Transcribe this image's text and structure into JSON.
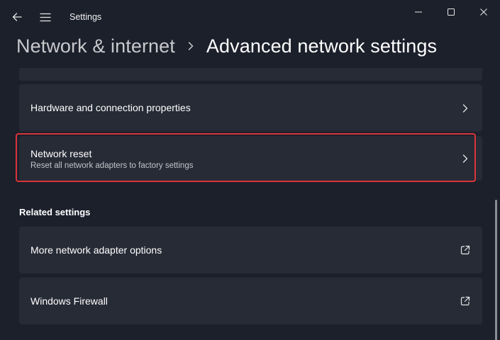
{
  "window": {
    "app_title": "Settings"
  },
  "titlebar": {
    "back_icon": "back-arrow-icon",
    "menu_icon": "hamburger-menu-icon",
    "minimize_icon": "minimize-icon",
    "maximize_icon": "maximize-icon",
    "close_icon": "close-icon"
  },
  "breadcrumb": {
    "parent": "Network & internet",
    "separator_icon": "chevron-right-icon",
    "current": "Advanced network settings"
  },
  "cards": {
    "hardware": {
      "title": "Hardware and connection properties",
      "icon": "chevron-right-icon"
    },
    "network_reset": {
      "title": "Network reset",
      "subtitle": "Reset all network adapters to factory settings",
      "icon": "chevron-right-icon"
    }
  },
  "related_settings": {
    "heading": "Related settings",
    "items": [
      {
        "title": "More network adapter options",
        "icon": "external-link-icon"
      },
      {
        "title": "Windows Firewall",
        "icon": "external-link-icon"
      }
    ]
  },
  "colors": {
    "background": "#1c202b",
    "card": "#272b36",
    "highlight": "#d9343a",
    "text": "#ffffff",
    "muted_text": "#c2c4c9"
  }
}
